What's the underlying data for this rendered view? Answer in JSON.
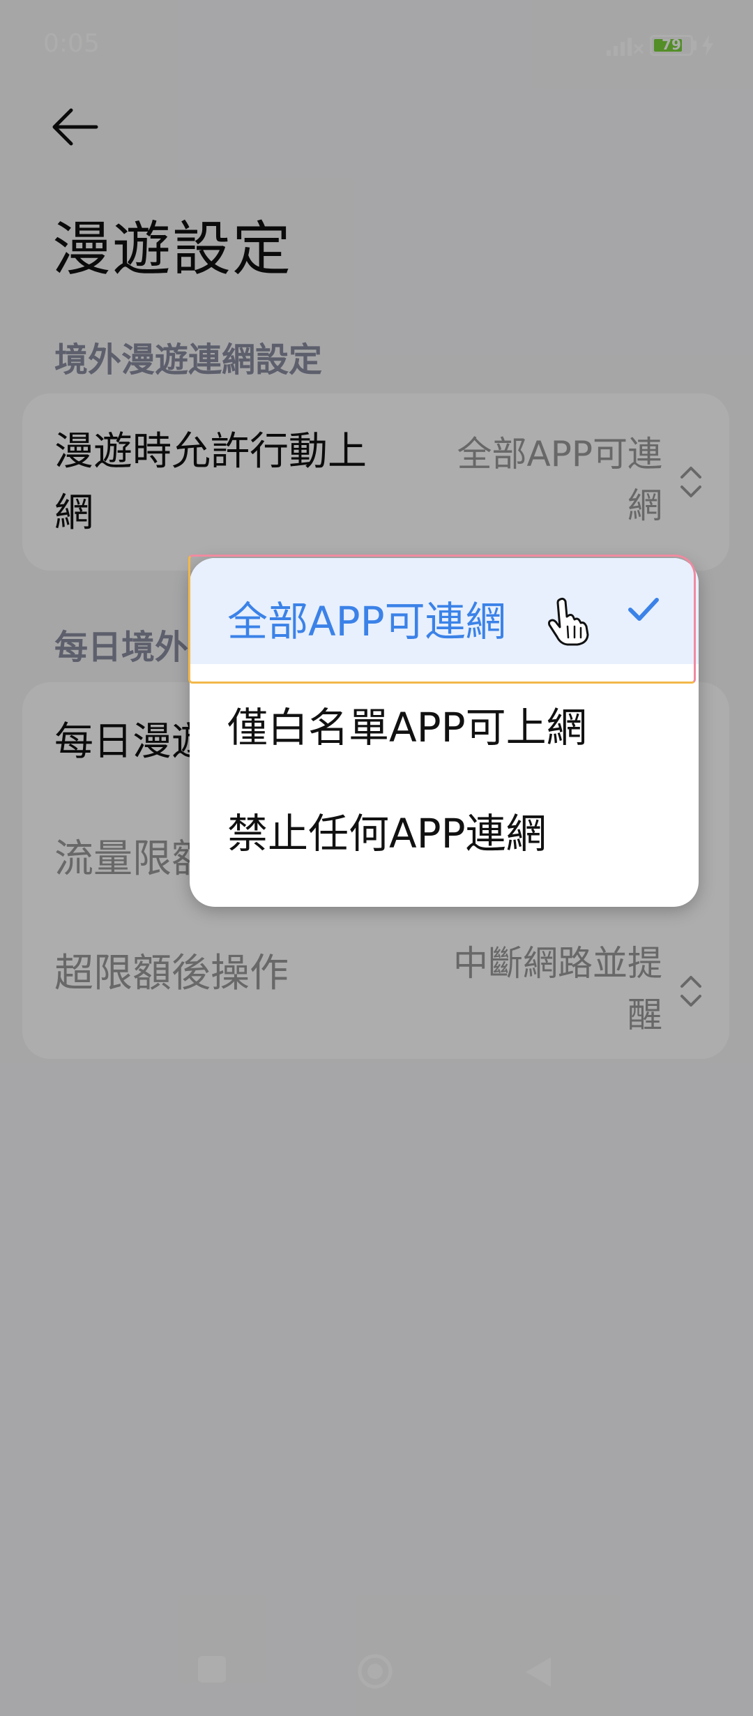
{
  "status_bar": {
    "time": "0:05",
    "battery_level": "79",
    "battery_fraction": 0.79,
    "icons": [
      "signal-icon",
      "battery-icon",
      "charging-icon"
    ]
  },
  "header": {
    "back_icon": "arrow-left-icon",
    "title": "漫遊設定"
  },
  "section1": {
    "label": "境外漫遊連網設定",
    "row": {
      "title_line1": "漫遊時允許行動上",
      "title_line2": "網",
      "value_line1": "全部APP可連",
      "value_line2": "網",
      "icon": "chevron-up-down-icon"
    }
  },
  "section2": {
    "label": "每日境外",
    "rows": [
      {
        "title": "每日漫遊"
      },
      {
        "title": "流量限額"
      },
      {
        "title": "超限額後操作",
        "value_line1": "中斷網路並提",
        "value_line2": "醒",
        "icon": "chevron-up-down-icon"
      }
    ]
  },
  "dropdown": {
    "items": [
      {
        "label": "全部APP可連網",
        "selected": true
      },
      {
        "label": "僅白名單APP可上網",
        "selected": false
      },
      {
        "label": "禁止任何APP連網",
        "selected": false
      }
    ],
    "check_icon": "check-icon",
    "cursor_icon": "hand-pointer-icon"
  },
  "nav_bar": {
    "icons": [
      "recents-square-icon",
      "home-circle-icon",
      "back-triangle-icon"
    ]
  },
  "colors": {
    "accent": "#3b82e8",
    "selected_bg": "#e8f0fe",
    "scrim": "rgba(0,0,0,0.32)",
    "section_label": "#8a8d9f"
  }
}
